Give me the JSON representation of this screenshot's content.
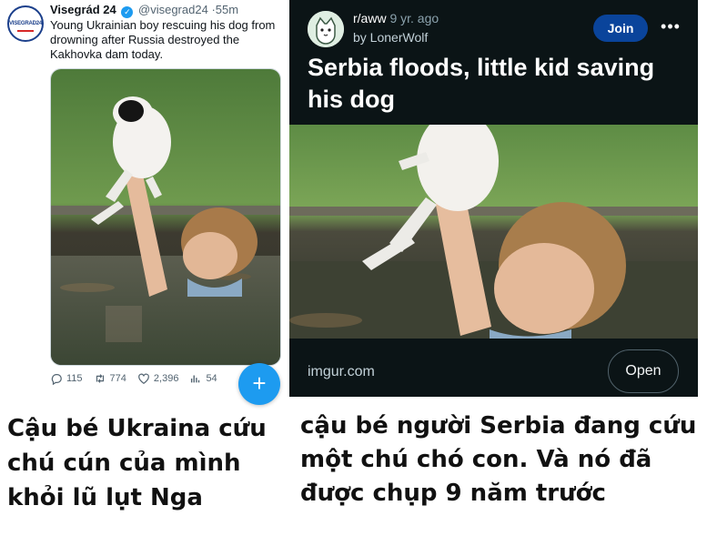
{
  "tweet": {
    "avatar_text": "VISEGRAD24",
    "display_name": "Visegrád 24",
    "handle": "@visegrad24",
    "time": "55m",
    "text": "Young Ukrainian boy rescuing his dog from drowning after Russia destroyed the Kakhovka dam today.",
    "replies": "115",
    "retweets": "774",
    "likes": "2,396",
    "views": "54",
    "fab_label": "+"
  },
  "reddit": {
    "subreddit": "r/aww",
    "age": "9 yr. ago",
    "user": "by LonerWolf",
    "join_label": "Join",
    "more_label": "•••",
    "title": "Serbia floods, little kid saving his dog",
    "domain": "imgur.com",
    "open_label": "Open",
    "colors": {
      "background": "#0b1416",
      "join": "#0a449b"
    }
  },
  "captions": {
    "left": "Cậu bé Ukraina cứu chú cún của mình khỏi lũ lụt Nga",
    "right": "cậu bé người Serbia đang cứu một chú chó con. Và nó đã được chụp 9 năm trước"
  },
  "icons": [
    "reply-icon",
    "retweet-icon",
    "like-icon",
    "views-icon",
    "verified-icon",
    "more-icon"
  ]
}
